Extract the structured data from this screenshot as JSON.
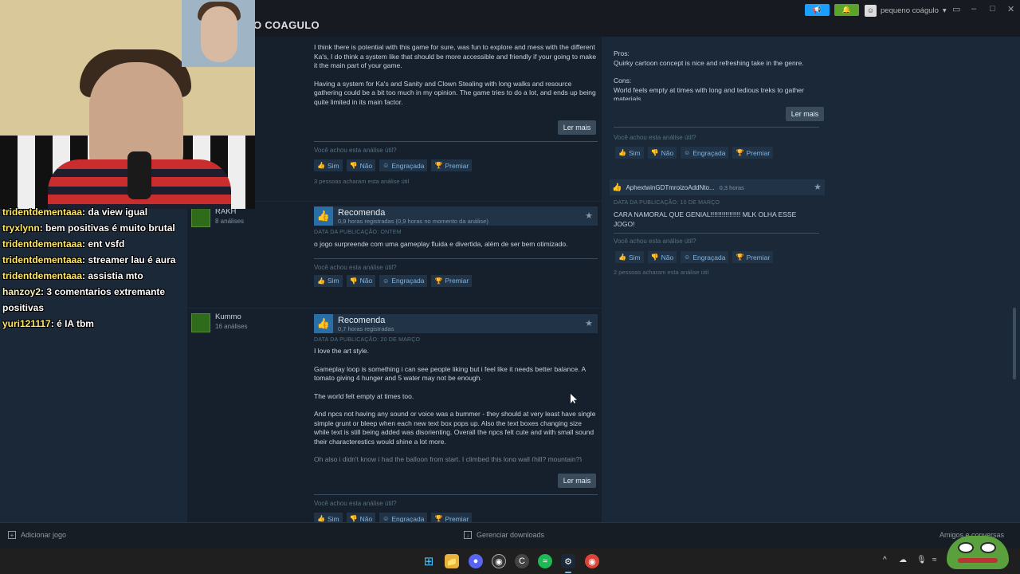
{
  "topbar": {
    "game_title": "O COAGULO",
    "username": "pequeno coágulo",
    "announce_icon": "megaphone-icon",
    "notify_icon": "bell-icon"
  },
  "reviews": [
    {
      "author": "",
      "author_count": "",
      "paragraphs": [
        "I think there is potential with this game for sure, was fun to explore and mess with the different Ka's, I do think a system like that should be more accessible and friendly if your going to make it the main part of your game.",
        "Having a system for Ka's and Sanity and Clown Stealing with long walks and resource gathering could be a bit too much in my opinion. The game tries to do a lot, and ends up being quite limited in its main factor."
      ],
      "read_more": "Ler mais",
      "helpful_q": "Você achou esta análise útil?",
      "votes": [
        "Sim",
        "Não",
        "Engraçada",
        "Premiar"
      ],
      "found_helpful": "3 pessoas acharam esta análise útil"
    },
    {
      "author": "RAKH",
      "author_count": "8 análises",
      "verdict": "Recomenda",
      "hours": "0,9 horas registradas (0,9 horas no momento da análise)",
      "date": "DATA DA PUBLICAÇÃO: ONTEM",
      "paragraphs": [
        "o jogo surpreende com uma gameplay fluida e divertida, além de ser bem otimizado."
      ],
      "helpful_q": "Você achou esta análise útil?",
      "votes": [
        "Sim",
        "Não",
        "Engraçada",
        "Premiar"
      ]
    },
    {
      "author": "Kummo",
      "author_count": "16 análises",
      "verdict": "Recomenda",
      "hours": "0,7 horas registradas",
      "date": "DATA DA PUBLICAÇÃO: 20 DE MARÇO",
      "paragraphs": [
        "I love the art style.",
        "Gameplay loop is something i can see people liking but i feel like it needs better balance. A tomato giving 4 hunger and 5 water may not be enough.",
        "The world felt empty at times too.",
        "And npcs not having any sound or voice was a bummer - they should at very least have single simple grunt or bleep when each new text box pops up. Also the text boxes changing size while text is still being added was disorienting. Overall the npcs felt cute and with small sound their characterestics would shine a lot more.",
        "Oh also i didn't know i had the balloon from start, I climbed this long wall (hill? mountain?)"
      ],
      "read_more": "Ler mais",
      "helpful_q": "Você achou esta análise útil?",
      "votes": [
        "Sim",
        "Não",
        "Engraçada",
        "Premiar"
      ]
    }
  ],
  "right_reviews": [
    {
      "lines": [
        "Pros:",
        "Quirky cartoon concept is nice and refreshing take in the genre.",
        "Cons:",
        "World feels empty at times with long and tedious treks to gather materials."
      ],
      "read_more": "Ler mais",
      "helpful_q": "Você achou esta análise útil?",
      "votes": [
        "Sim",
        "Não",
        "Engraçada",
        "Premiar"
      ]
    },
    {
      "author": "AphextwinGDTmroizoAddNto...",
      "hours": "0,3 horas",
      "date": "DATA DA PUBLICAÇÃO: 10 DE MARÇO",
      "text": "CARA NAMORAL QUE GENIAL!!!!!!!!!!!!!!!! MLK OLHA ESSE JOGO!",
      "helpful_q": "Você achou esta análise útil?",
      "votes": [
        "Sim",
        "Não",
        "Engraçada",
        "Premiar"
      ],
      "found_helpful": "2 pessoas acharam esta análise útil"
    }
  ],
  "chat": [
    {
      "user": "tridentdementaaa",
      "msg": "da view igual"
    },
    {
      "user": "tryxlynn",
      "msg": "bem positivas é muito brutal"
    },
    {
      "user": "tridentdementaaa",
      "msg": "ent vsfd"
    },
    {
      "user": "tridentdementaaa",
      "msg": "streamer lau é aura"
    },
    {
      "user": "tridentdementaaa",
      "msg": "assistia mto"
    },
    {
      "user": "hanzoy2",
      "msg": "3 comentarios extremante"
    },
    {
      "user": "",
      "msg": "positivas"
    },
    {
      "user": "yuri121117",
      "msg": "é IA tbm"
    }
  ],
  "footer": {
    "add_game": "Adicionar jogo",
    "downloads": "Gerenciar downloads",
    "friends": "Amigos e conversas"
  },
  "taskbar_icons": [
    "windows-start-icon",
    "file-explorer-icon",
    "discord-icon",
    "obs-icon",
    "ccleaner-icon",
    "spotify-icon",
    "steam-icon",
    "chrome-icon"
  ],
  "colors": {
    "bg": "#1b2838",
    "review_bg": "#16202d",
    "accent_blue": "#1a9fff",
    "accent_green": "#5ba32b",
    "vote_text": "#7fb3e0"
  }
}
